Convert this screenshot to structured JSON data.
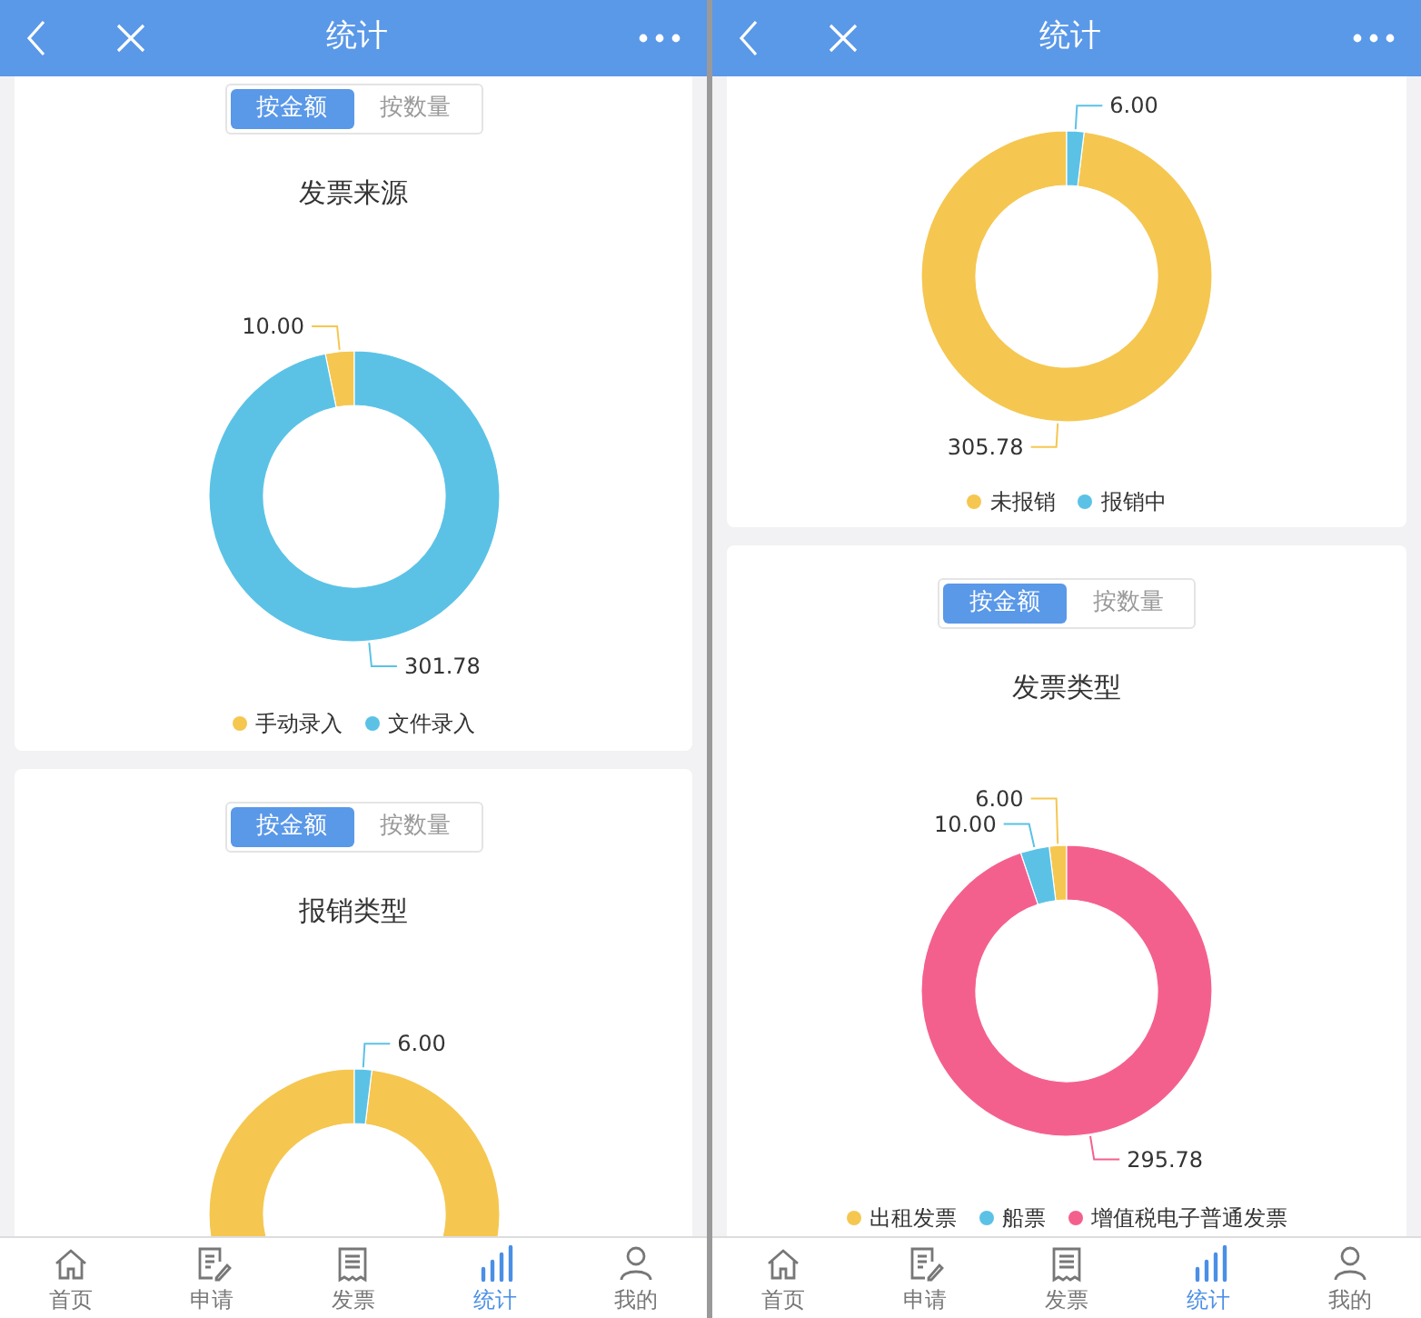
{
  "panes": [
    {
      "header": {
        "title": "统计"
      },
      "cards": [
        {
          "toggle": [
            {
              "label": "按金额",
              "selected": true
            },
            {
              "label": "按数量",
              "selected": false
            }
          ],
          "chart_data": {
            "type": "donut",
            "title": "发票来源",
            "values": [
              10.0,
              301.78
            ],
            "value_labels": [
              "10.00",
              "301.78"
            ]
          },
          "legend": [
            {
              "label": "手动录入",
              "color": "#f5c751"
            },
            {
              "label": "文件录入",
              "color": "#5bc2e6"
            }
          ]
        },
        {
          "toggle": [
            {
              "label": "按金额",
              "selected": true
            },
            {
              "label": "按数量",
              "selected": false
            }
          ],
          "chart_data": {
            "type": "donut",
            "title": "报销类型",
            "values": [
              305.78,
              6.0
            ],
            "value_labels": [
              null,
              "6.00"
            ]
          },
          "slices": [
            {
              "color": "#f5c751"
            },
            {
              "color": "#5bc2e6"
            }
          ]
        }
      ],
      "tab_bar": [
        {
          "label": "首页",
          "selected": false
        },
        {
          "label": "申请",
          "selected": false
        },
        {
          "label": "发票",
          "selected": false
        },
        {
          "label": "统计",
          "selected": true
        },
        {
          "label": "我的",
          "selected": false
        }
      ]
    },
    {
      "header": {
        "title": "统计"
      },
      "cards": [
        {
          "chart_data": {
            "type": "donut",
            "values": [
              305.78,
              6.0
            ],
            "value_labels": [
              "305.78",
              "6.00"
            ]
          },
          "legend": [
            {
              "label": "未报销",
              "color": "#f5c751"
            },
            {
              "label": "报销中",
              "color": "#5bc2e6"
            }
          ]
        },
        {
          "toggle": [
            {
              "label": "按金额",
              "selected": true
            },
            {
              "label": "按数量",
              "selected": false
            }
          ],
          "chart_data": {
            "type": "donut",
            "title": "发票类型",
            "values": [
              6.0,
              10.0,
              295.78
            ],
            "value_labels": [
              "6.00",
              "10.00",
              "295.78"
            ]
          },
          "legend": [
            {
              "label": "出租发票",
              "color": "#f5c751"
            },
            {
              "label": "船票",
              "color": "#5bc2e6"
            },
            {
              "label": "增值税电子普通发票",
              "color": "#f4608e"
            }
          ]
        }
      ],
      "tab_bar": [
        {
          "label": "首页",
          "selected": false
        },
        {
          "label": "申请",
          "selected": false
        },
        {
          "label": "发票",
          "selected": false
        },
        {
          "label": "统计",
          "selected": true
        },
        {
          "label": "我的",
          "selected": false
        }
      ]
    }
  ]
}
